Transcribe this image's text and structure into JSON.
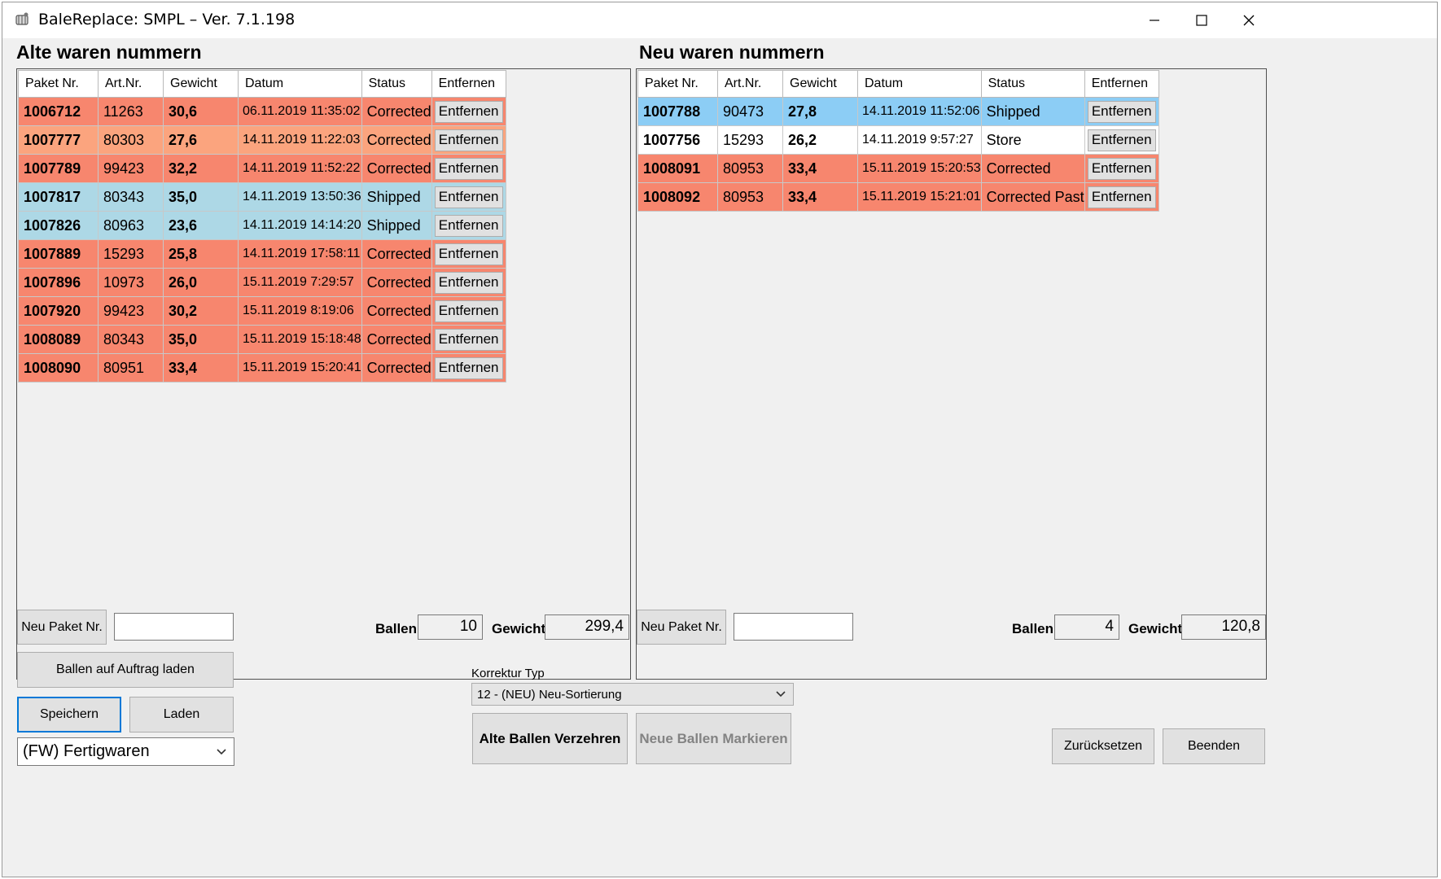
{
  "window": {
    "title": "BaleReplace: SMPL – Ver. 7.1.198"
  },
  "left": {
    "title": "Alte waren nummern",
    "columns": [
      "Paket Nr.",
      "Art.Nr.",
      "Gewicht",
      "Datum",
      "Status",
      "Entfernen"
    ],
    "rows": [
      {
        "paket": "1006712",
        "art": "11263",
        "gewicht": "30,6",
        "datum": "06.11.2019 11:35:02",
        "status": "Corrected",
        "action": "Entfernen",
        "color": "#f7866e"
      },
      {
        "paket": "1007777",
        "art": "80303",
        "gewicht": "27,6",
        "datum": "14.11.2019 11:22:03",
        "status": "Corrected",
        "action": "Entfernen",
        "color": "#fba47e"
      },
      {
        "paket": "1007789",
        "art": "99423",
        "gewicht": "32,2",
        "datum": "14.11.2019 11:52:22",
        "status": "Corrected",
        "action": "Entfernen",
        "color": "#f7866e"
      },
      {
        "paket": "1007817",
        "art": "80343",
        "gewicht": "35,0",
        "datum": "14.11.2019 13:50:36",
        "status": "Shipped",
        "action": "Entfernen",
        "color": "#add8e6"
      },
      {
        "paket": "1007826",
        "art": "80963",
        "gewicht": "23,6",
        "datum": "14.11.2019 14:14:20",
        "status": "Shipped",
        "action": "Entfernen",
        "color": "#add8e6"
      },
      {
        "paket": "1007889",
        "art": "15293",
        "gewicht": "25,8",
        "datum": "14.11.2019 17:58:11",
        "status": "Corrected",
        "action": "Entfernen",
        "color": "#f7866e"
      },
      {
        "paket": "1007896",
        "art": "10973",
        "gewicht": "26,0",
        "datum": "15.11.2019 7:29:57",
        "status": "Corrected",
        "action": "Entfernen",
        "color": "#f7866e"
      },
      {
        "paket": "1007920",
        "art": "99423",
        "gewicht": "30,2",
        "datum": "15.11.2019 8:19:06",
        "status": "Corrected",
        "action": "Entfernen",
        "color": "#f7866e"
      },
      {
        "paket": "1008089",
        "art": "80343",
        "gewicht": "35,0",
        "datum": "15.11.2019 15:18:48",
        "status": "Corrected",
        "action": "Entfernen",
        "color": "#f7866e"
      },
      {
        "paket": "1008090",
        "art": "80951",
        "gewicht": "33,4",
        "datum": "15.11.2019 15:20:41",
        "status": "Corrected",
        "action": "Entfernen",
        "color": "#f7866e"
      }
    ],
    "new_paket_label": "Neu Paket Nr.",
    "new_paket_value": "",
    "ballen_label": "Ballen",
    "ballen_value": "10",
    "gewicht_label": "Gewicht",
    "gewicht_value": "299,4"
  },
  "right": {
    "title": "Neu waren nummern",
    "columns": [
      "Paket Nr.",
      "Art.Nr.",
      "Gewicht",
      "Datum",
      "Status",
      "Entfernen"
    ],
    "rows": [
      {
        "paket": "1007788",
        "art": "90473",
        "gewicht": "27,8",
        "datum": "14.11.2019 11:52:06",
        "status": "Shipped",
        "action": "Entfernen",
        "color": "#8ccdf5"
      },
      {
        "paket": "1007756",
        "art": "15293",
        "gewicht": "26,2",
        "datum": "14.11.2019 9:57:27",
        "status": "Store",
        "action": "Entfernen",
        "color": "#ffffff"
      },
      {
        "paket": "1008091",
        "art": "80953",
        "gewicht": "33,4",
        "datum": "15.11.2019 15:20:53",
        "status": "Corrected",
        "action": "Entfernen",
        "color": "#f7866e"
      },
      {
        "paket": "1008092",
        "art": "80953",
        "gewicht": "33,4",
        "datum": "15.11.2019 15:21:01",
        "status": "Corrected Past",
        "action": "Entfernen",
        "color": "#f7866e"
      }
    ],
    "new_paket_label": "Neu Paket Nr.",
    "new_paket_value": "",
    "ballen_label": "Ballen",
    "ballen_value": "4",
    "gewicht_label": "Gewicht",
    "gewicht_value": "120,8"
  },
  "controls": {
    "load_order_label": "Ballen auf Auftrag laden",
    "save_label": "Speichern",
    "load_label": "Laden",
    "warehouse_selected": "(FW) Fertigwaren",
    "korrektur_label": "Korrektur Typ",
    "korrektur_selected": "12 - (NEU) Neu-Sortierung",
    "consume_label": "Alte Ballen Verzehren",
    "mark_label": "Neue Ballen Markieren",
    "reset_label": "Zurücksetzen",
    "exit_label": "Beenden"
  },
  "icons": {
    "app": "bale-app-icon",
    "minimize": "minimize-icon",
    "maximize": "maximize-icon",
    "close": "close-icon",
    "dropdown": "chevron-down-icon"
  },
  "colors": {
    "corrected": "#f7866e",
    "corrected_light": "#fba47e",
    "shipped": "#add8e6",
    "shipped_selected": "#8ccdf5",
    "store": "#ffffff",
    "focus": "#0078d7"
  }
}
